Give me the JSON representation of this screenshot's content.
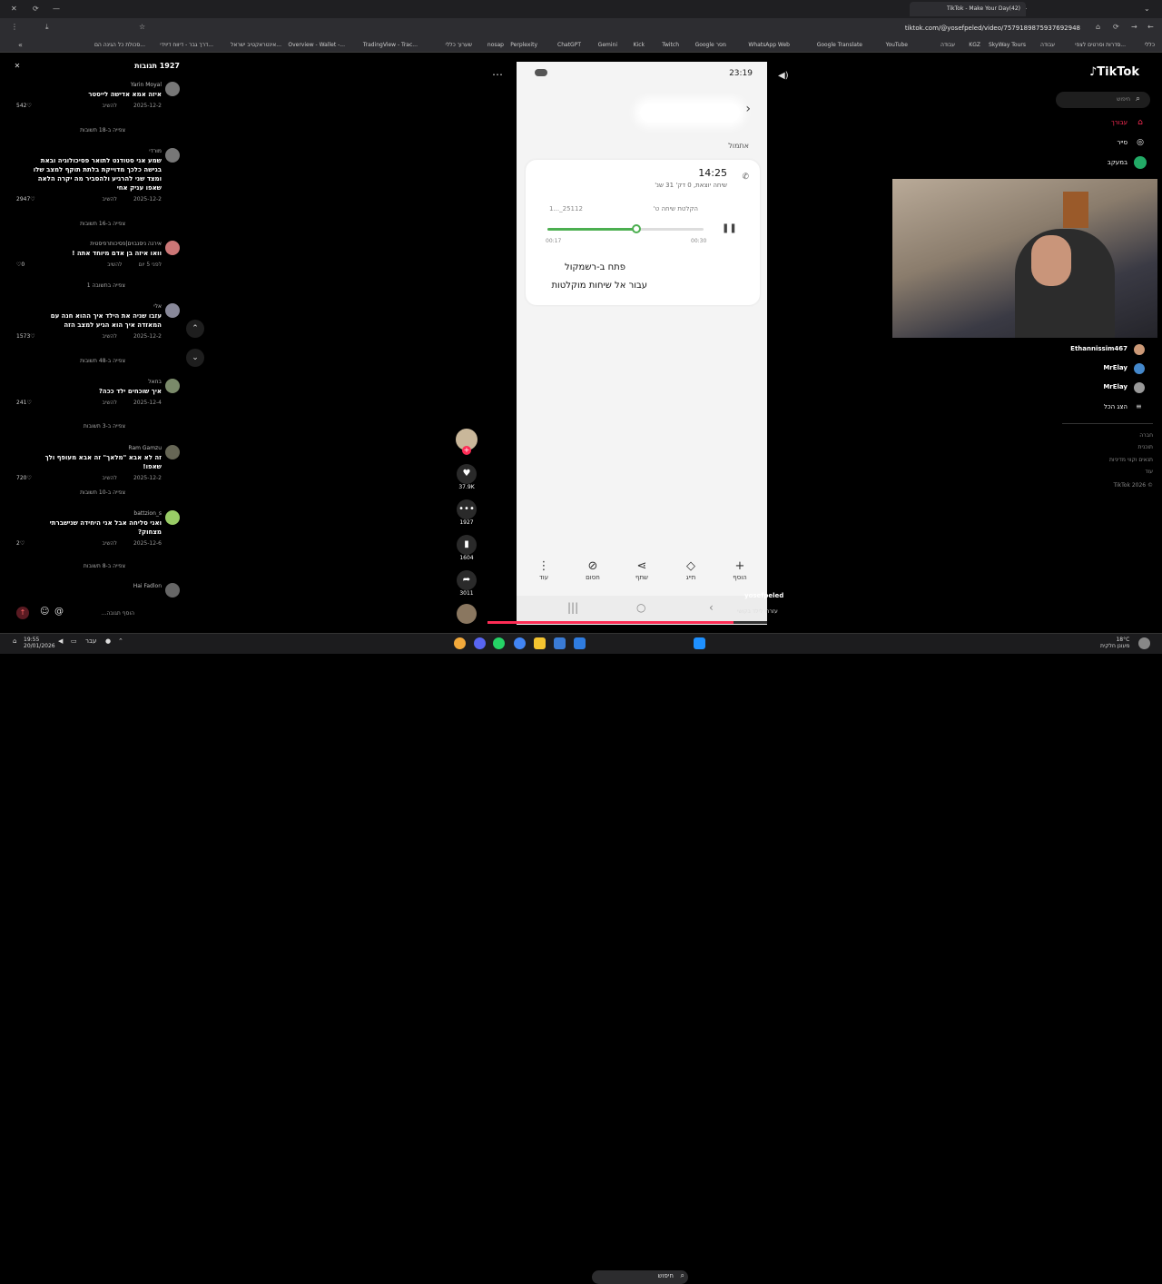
{
  "browser": {
    "tab_title": "(42)TikTok - Make Your Day",
    "url": "tiktok.com/@yosefpeled/video/7579189875937692948",
    "bookmarks": [
      "כללי",
      "סדרות וסרטים לצפי...",
      "עבודה",
      "SkyWay Tours",
      "KGZ",
      "עבודה",
      "YouTube",
      "Google Translate",
      "WhatsApp Web",
      "Google מסר",
      "Twitch",
      "Kick",
      "Gemini",
      "ChatGPT",
      "Perplexity",
      "nosap",
      "שערוך כללי",
      "TradingView - Trac...",
      "Overview - Wallet -...",
      "אינטראקטיב ישראל...",
      "דרך גבר - דיווח דיוידי...",
      "סכולת כל הגינה הם..."
    ]
  },
  "comments": {
    "header": "1927 תגובות",
    "items": [
      {
        "name": "Yarin Moyal",
        "text": "איזה אמא אדישה לייסטר",
        "date": "2025-12-2",
        "likes": "542",
        "reply": "להשיב",
        "replies": "צפייה ב-18 תשובות"
      },
      {
        "name": "מורדי",
        "text": "שמע אני סטודנט לתואר פסיכולוגיה ובאת בגישה כלכך מדוייקת בלתת תוקף למצב שלו ומצד שני להרגיע ולהסביר מה יקרה הלאה שאפו עניק אחי",
        "date": "2025-12-2",
        "likes": "2947",
        "reply": "להשיב",
        "replies": "צפייה ב-16 תשובות"
      },
      {
        "name": "אירנה ניסנבוים|פסיכותרפיסטית",
        "text": "וואו איזה בן אדם מיוחד אתה !",
        "date": "לפני 5 יום",
        "likes": "0",
        "reply": "להשיב",
        "replies": "צפייה בתשובה 1"
      },
      {
        "name": "אלי",
        "text": "עזבו שניה את הילד איך ההוא חנה עם המאזדה איך הוא הגיע למצב הזה",
        "date": "2025-12-2",
        "likes": "1573",
        "reply": "להשיב",
        "replies": "צפייה ב-48 תשובות"
      },
      {
        "name": "בחאל",
        "text": "איך שוכחים ילד ככה?",
        "date": "2025-12-4",
        "likes": "241",
        "reply": "להשיב",
        "replies": "צפייה ב-3 תשובות"
      },
      {
        "name": "Ram Gamzu",
        "text": "זה לא אבא \"מלאך\" זה אבא מעופף ולך שאפו!",
        "date": "2025-12-2",
        "likes": "720",
        "reply": "להשיב",
        "replies": "צפייה ב-10 תשובות"
      },
      {
        "name": "battzion_s",
        "text": "ואני סליחה אבל אני היחידה שנישברתי מצחוק?",
        "date": "2025-12-6",
        "likes": "2",
        "reply": "להשיב",
        "replies": "צפייה ב-8 תשובות"
      },
      {
        "name": "Hai Fadlon",
        "text": "",
        "date": "",
        "likes": "",
        "reply": "",
        "replies": ""
      }
    ],
    "input_placeholder": "הוסף תגובה..."
  },
  "video": {
    "status_time": "23:19",
    "yesterday": "אתמול",
    "call_time": "14:25",
    "call_sub": "שיחה יוצאת, 0 דק' 31 שנ'",
    "rec_name": "הקלטת שיחה ט'",
    "rec_id": "1..._25112",
    "progress_start": "00:17",
    "progress_end": "00:30",
    "progress_fraction": 0.57,
    "open_recorder": "פתח ב-רשמקול",
    "go_recordings": "עבור אל שיחות מוקלטות",
    "actions": [
      "הוסף",
      "תייג",
      "שתף",
      "חסום",
      "עוד"
    ],
    "author": "yosefpeled",
    "caption": "עזרתי לילד בקושי",
    "playback_fraction": 0.88
  },
  "actions": {
    "likes": "37.9K",
    "comments": "1927",
    "saves": "1604",
    "shares": "3011"
  },
  "sidebar": {
    "logo": "TikTok",
    "search_placeholder": "חיפוש",
    "nav": [
      "עבורך",
      "סייר",
      "במעקב"
    ],
    "following": [
      "Ethannissim467",
      "MrElay",
      "MrElay"
    ],
    "show_all": "הצג הכל",
    "footer": [
      "חברה",
      "תוכנית",
      "תנאים וקווי מדיניות",
      "עוד",
      "TikTok 2026 ©"
    ]
  },
  "taskbar": {
    "time": "19:55",
    "date": "20/01/2026",
    "lang": "עבר",
    "search": "חיפוש",
    "weather": "18°C",
    "weather_desc": "מעונן חלקית"
  }
}
